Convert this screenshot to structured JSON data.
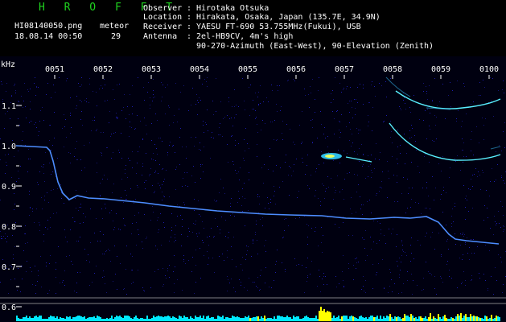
{
  "app": {
    "title": "H R O F F T"
  },
  "file": {
    "name": "HI08140050.png",
    "datetime": "18.08.14 00:50"
  },
  "meteor": {
    "label": "meteor",
    "count": "29"
  },
  "info": [
    {
      "key": "Observer",
      "value": "Hirotaka Otsuka"
    },
    {
      "key": "Location",
      "value": "Hirakata, Osaka, Japan (135.7E, 34.9N)"
    },
    {
      "key": "Receiver",
      "value": "YAESU FT-690 53.755MHz(Fukui), USB"
    },
    {
      "key": "Antenna",
      "value": "2el-HB9CV, 4m's high"
    }
  ],
  "antenna_line2": "90-270-Azimuth (East-West), 90-Elevation (Zenith)",
  "axis": {
    "unit": "kHz",
    "y_ticks": [
      "1.1",
      "1.0",
      "0.9",
      "0.8",
      "0.7",
      "0.6"
    ],
    "x_ticks": [
      "0051",
      "0052",
      "0053",
      "0054",
      "0055",
      "0056",
      "0057",
      "0058",
      "0059",
      "0100"
    ]
  },
  "colors": {
    "background": "#000010",
    "noise": "#16168a",
    "trace": "#4d8dff",
    "echo": "#59f0ff",
    "meter": "#00e8ff",
    "burst": "#ffff00"
  }
}
